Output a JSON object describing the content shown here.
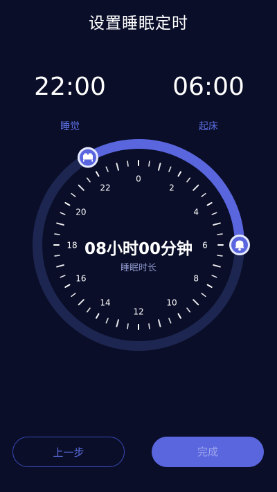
{
  "header": {
    "title": "设置睡眠定时"
  },
  "sleep": {
    "time": "22:00",
    "label": "睡觉"
  },
  "wake": {
    "time": "06:00",
    "label": "起床"
  },
  "dial": {
    "hour_labels": [
      "0",
      "2",
      "4",
      "6",
      "8",
      "10",
      "12",
      "14",
      "16",
      "18",
      "20",
      "22"
    ],
    "duration": "08小时00分钟",
    "duration_label": "睡眠时长",
    "arc_start_hour": 22,
    "arc_end_hour": 6,
    "colors": {
      "track": "#1c2650",
      "arc": "#5a66de",
      "tick": "#ffffff"
    }
  },
  "footer": {
    "prev_label": "上一步",
    "done_label": "完成"
  },
  "colors": {
    "background": "#0a0e28",
    "accent": "#5a66de"
  },
  "icons": {
    "sleep_handle": "bed-icon",
    "wake_handle": "bell-icon"
  }
}
